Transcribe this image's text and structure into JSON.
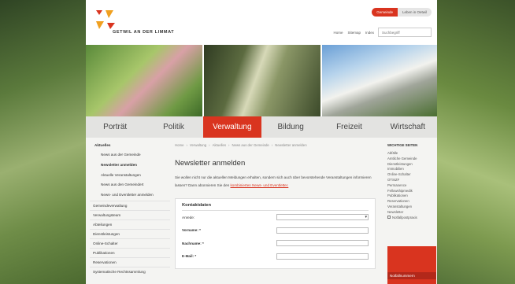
{
  "header": {
    "logo_text": "GETWIL AN DER LIMMAT",
    "toggle": {
      "active": "Gemeinde",
      "inactive": "Leben in Oetwil"
    },
    "links": [
      "Home",
      "Sitemap",
      "Index"
    ],
    "search_placeholder": "Suchbegriff"
  },
  "nav": {
    "items": [
      "Porträt",
      "Politik",
      "Verwaltung",
      "Bildung",
      "Freizeit",
      "Wirtschaft"
    ],
    "active": "Verwaltung"
  },
  "sidebar": {
    "heading": "Aktuelles",
    "sub_items": [
      "News aus der Gemeinde",
      "Newsletter anmelden",
      "Aktuelle Veranstaltungen",
      "News aus den Gemeindert",
      "News- und Eventletter anmelden"
    ],
    "main_items": [
      "Gemeindeverwaltung",
      "Verwaltungsteam",
      "Abteilungen",
      "Dienstleistungen",
      "Online-Schalter",
      "Publikationen",
      "Reservationen",
      "Systematische Rechtssammlung"
    ]
  },
  "content": {
    "breadcrumb": [
      "Home",
      "Verwaltung",
      "Aktuelles",
      "News aus der Gemeinde",
      "Newsletter anmelden"
    ],
    "title": "Newsletter anmelden",
    "intro": "Sie wollen nicht nur die aktuellen Meldungen erhalten, sondern sich auch über bevorstehende Veranstaltungen informieren lassen? Dann abonnieren Sie den",
    "intro_link": "kombinierten News- und Eventletter.",
    "form": {
      "title": "Kontaktdaten",
      "fields": [
        {
          "label": "Anrede:",
          "type": "select"
        },
        {
          "label": "Vorname: *",
          "type": "text"
        },
        {
          "label": "Nachname: *",
          "type": "text"
        },
        {
          "label": "E-Mail: *",
          "type": "text"
        }
      ]
    }
  },
  "right": {
    "heading": "WICHTIGE SEITEN",
    "items": [
      "Abfälle",
      "Amtliche Gemeinde",
      "Dienstleistungen",
      "Immobilien",
      "Online-Schalter",
      "OTSIZF",
      "Permanence",
      "Fellowshipmedik",
      "Publikationen",
      "Reservationen",
      "Veranstaltungen",
      "Newsletter"
    ],
    "checkbox_item": "Notfallpostpraxis",
    "notfall_label": "Notfallnummern"
  },
  "colors": {
    "accent": "#d9341f"
  }
}
